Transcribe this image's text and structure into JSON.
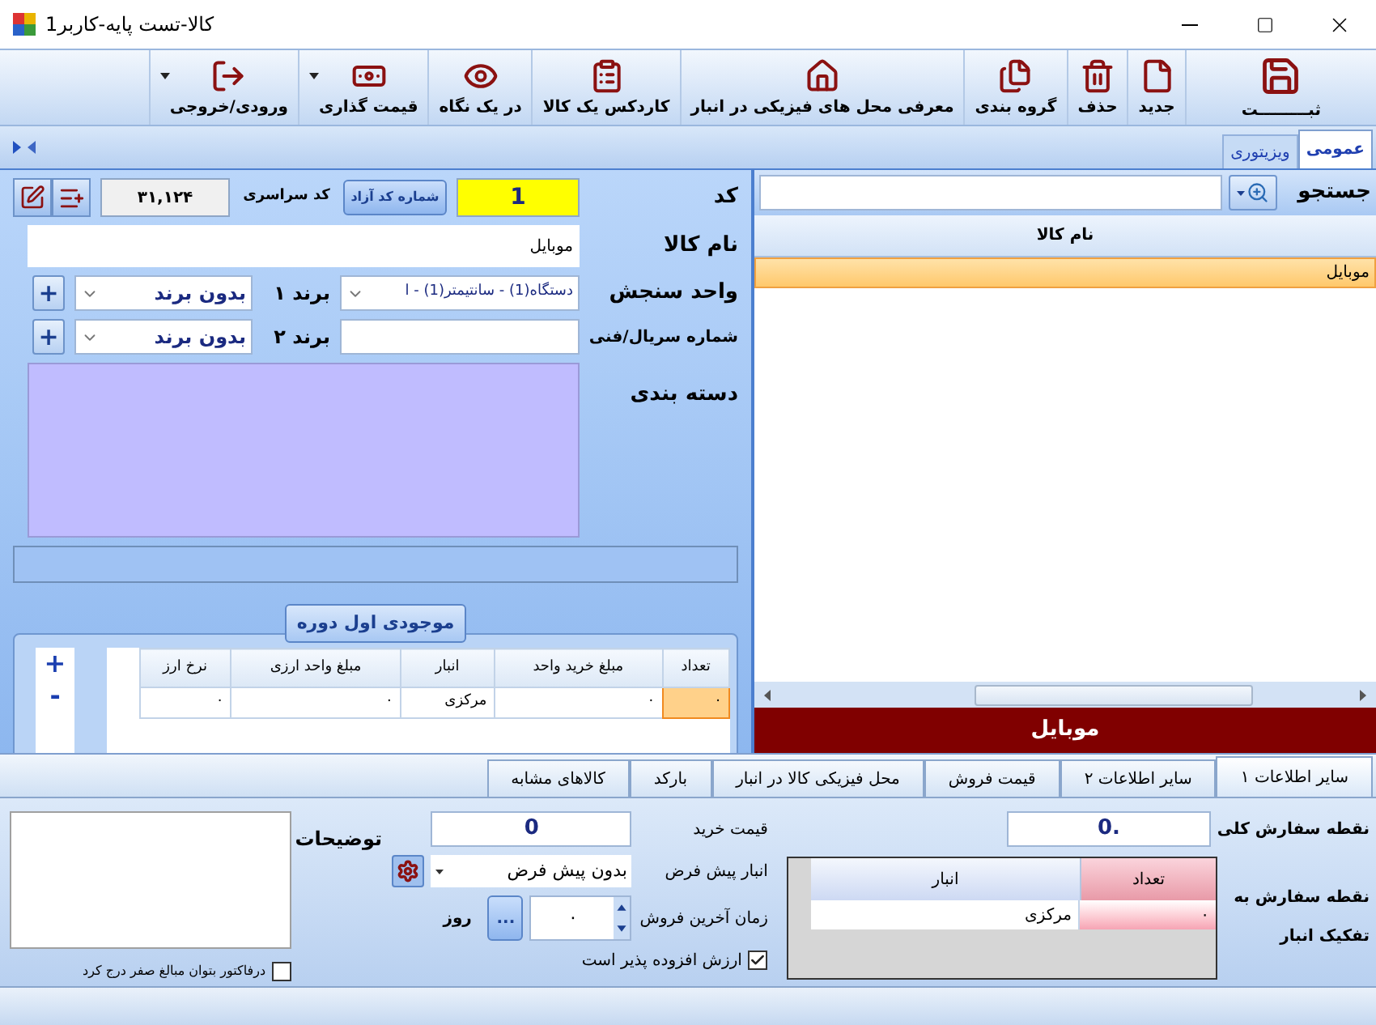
{
  "window": {
    "title": "کالا-تست پایه-کاربر1"
  },
  "toolbar": [
    {
      "kind": "save",
      "label": "ثبـــــــــت",
      "dropdown": false
    },
    {
      "kind": "new",
      "label": "جدید",
      "dropdown": false
    },
    {
      "kind": "delete",
      "label": "حذف",
      "dropdown": false
    },
    {
      "kind": "group",
      "label": "گروه بندی",
      "dropdown": false
    },
    {
      "kind": "warehouse",
      "label": "معرفی محل های فیزیکی در انبار",
      "dropdown": false
    },
    {
      "kind": "cardex",
      "label": "کاردکس یک کالا",
      "dropdown": false
    },
    {
      "kind": "glance",
      "label": "در یک نگاه",
      "dropdown": false
    },
    {
      "kind": "pricing",
      "label": "قیمت گذاری",
      "dropdown": true
    },
    {
      "kind": "inout",
      "label": "ورودی/خروجی",
      "dropdown": true
    }
  ],
  "main_tabs": [
    {
      "label": "عمومی",
      "selected": true
    },
    {
      "label": "ویزیتوری",
      "selected": false
    }
  ],
  "form": {
    "code_label": "کد",
    "code": "1",
    "free_code_button": "شماره کد آزاد",
    "global_code_label": "کد سراسری",
    "global_code": "۳۱,۱۲۴",
    "name_label": "نام کالا",
    "name": "موبایل",
    "unit_label": "واحد سنجش",
    "unit": "دستگاه(1) - سانتیمتر(1) - ا",
    "brand1_label": "برند ۱",
    "brand1": "بدون برند",
    "brand1_add": "+",
    "serial_label": "شماره سریال/فنی",
    "brand2_label": "برند ۲",
    "brand2": "بدون برند",
    "brand2_add": "+",
    "category_label": "دسته بندی"
  },
  "opening_stock": {
    "title": "موجودی اول دوره",
    "add": "+",
    "remove": "-",
    "columns": [
      "تعداد",
      "مبلغ خرید واحد",
      "انبار",
      "مبلغ واحد ارزی",
      "نرخ ارز"
    ],
    "rows": [
      {
        "cells": [
          {
            "text": "۰",
            "selected": true
          },
          {
            "text": "۰",
            "selected": false
          },
          {
            "text": "مرکزی",
            "selected": false
          },
          {
            "text": "۰",
            "selected": false
          },
          {
            "text": "۰",
            "selected": false
          }
        ]
      }
    ]
  },
  "search": {
    "label": "جستجو"
  },
  "goods_list": {
    "columns": [
      "نام کالا"
    ],
    "rows": [
      {
        "name": "موبایل",
        "selected": true
      }
    ]
  },
  "selected_banner": "موبایل",
  "detail_tabs": [
    {
      "label": "سایر اطلاعات ۱",
      "selected": true
    },
    {
      "label": "سایر اطلاعات ۲",
      "selected": false
    },
    {
      "label": "قیمت فروش",
      "selected": false
    },
    {
      "label": "محل فیزیکی کالا در انبار",
      "selected": false
    },
    {
      "label": "بارکد",
      "selected": false
    },
    {
      "label": "کالاهای مشابه",
      "selected": false
    }
  ],
  "other_info": {
    "reorder_label": "نقطه سفارش کلی",
    "reorder": ".0",
    "per_warehouse_label": "نقطه سفارش به تفکیک انبار",
    "warehouse_grid": {
      "columns": [
        "تعداد",
        "انبار"
      ],
      "rows": [
        {
          "cells": [
            "۰",
            "مرکزی"
          ]
        }
      ]
    },
    "purchase_price_label": "قیمت خرید",
    "purchase_price": "0",
    "default_wh_label": "انبار پیش فرض",
    "default_wh": "بدون پیش فرض",
    "last_sale_label": "زمان آخرین فروش",
    "last_sale": "۰",
    "browse": "...",
    "days": "روز",
    "vat": {
      "label": "ارزش افزوده پذیر است",
      "checked": true
    },
    "notes_label": "توضیحات",
    "zero_amount": {
      "label": "درفاکتور بتوان مبالغ صفر درج کرد",
      "checked": false
    }
  }
}
